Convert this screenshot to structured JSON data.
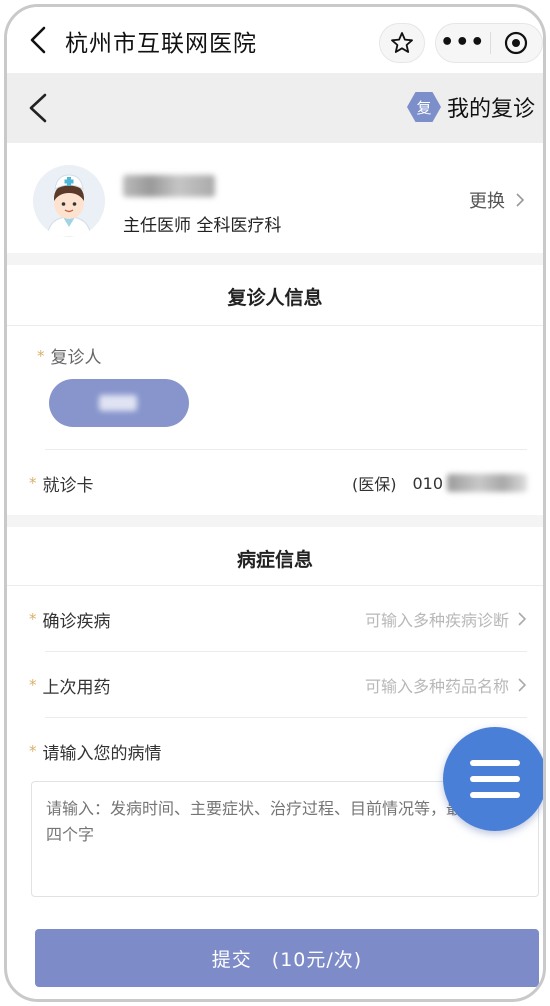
{
  "topbar": {
    "title": "杭州市互联网医院",
    "more_label": "•••"
  },
  "header": {
    "badge": "复",
    "title": "我的复诊"
  },
  "doctor": {
    "title": "主任医师 全科医疗科",
    "change_label": "更换"
  },
  "patient_section": {
    "title": "复诊人信息",
    "patient_label": "复诊人",
    "required_mark": "*",
    "card_label": "就诊卡",
    "card_type": "(医保)",
    "card_prefix": "010"
  },
  "illness_section": {
    "title": "病症信息",
    "diagnosis_label": "确诊疾病",
    "diagnosis_placeholder": "可输入多种疾病诊断",
    "medicine_label": "上次用药",
    "medicine_placeholder": "可输入多种药品名称",
    "condition_label": "请输入您的病情",
    "condition_placeholder": "请输入：发病时间、主要症状、治疗过程、目前情况等，最少输入四个字"
  },
  "submit": {
    "label": "提交　(10元/次)"
  },
  "colors": {
    "accent": "#7d8bc8",
    "fab": "#4a7fd7",
    "required": "#d9b06b"
  }
}
